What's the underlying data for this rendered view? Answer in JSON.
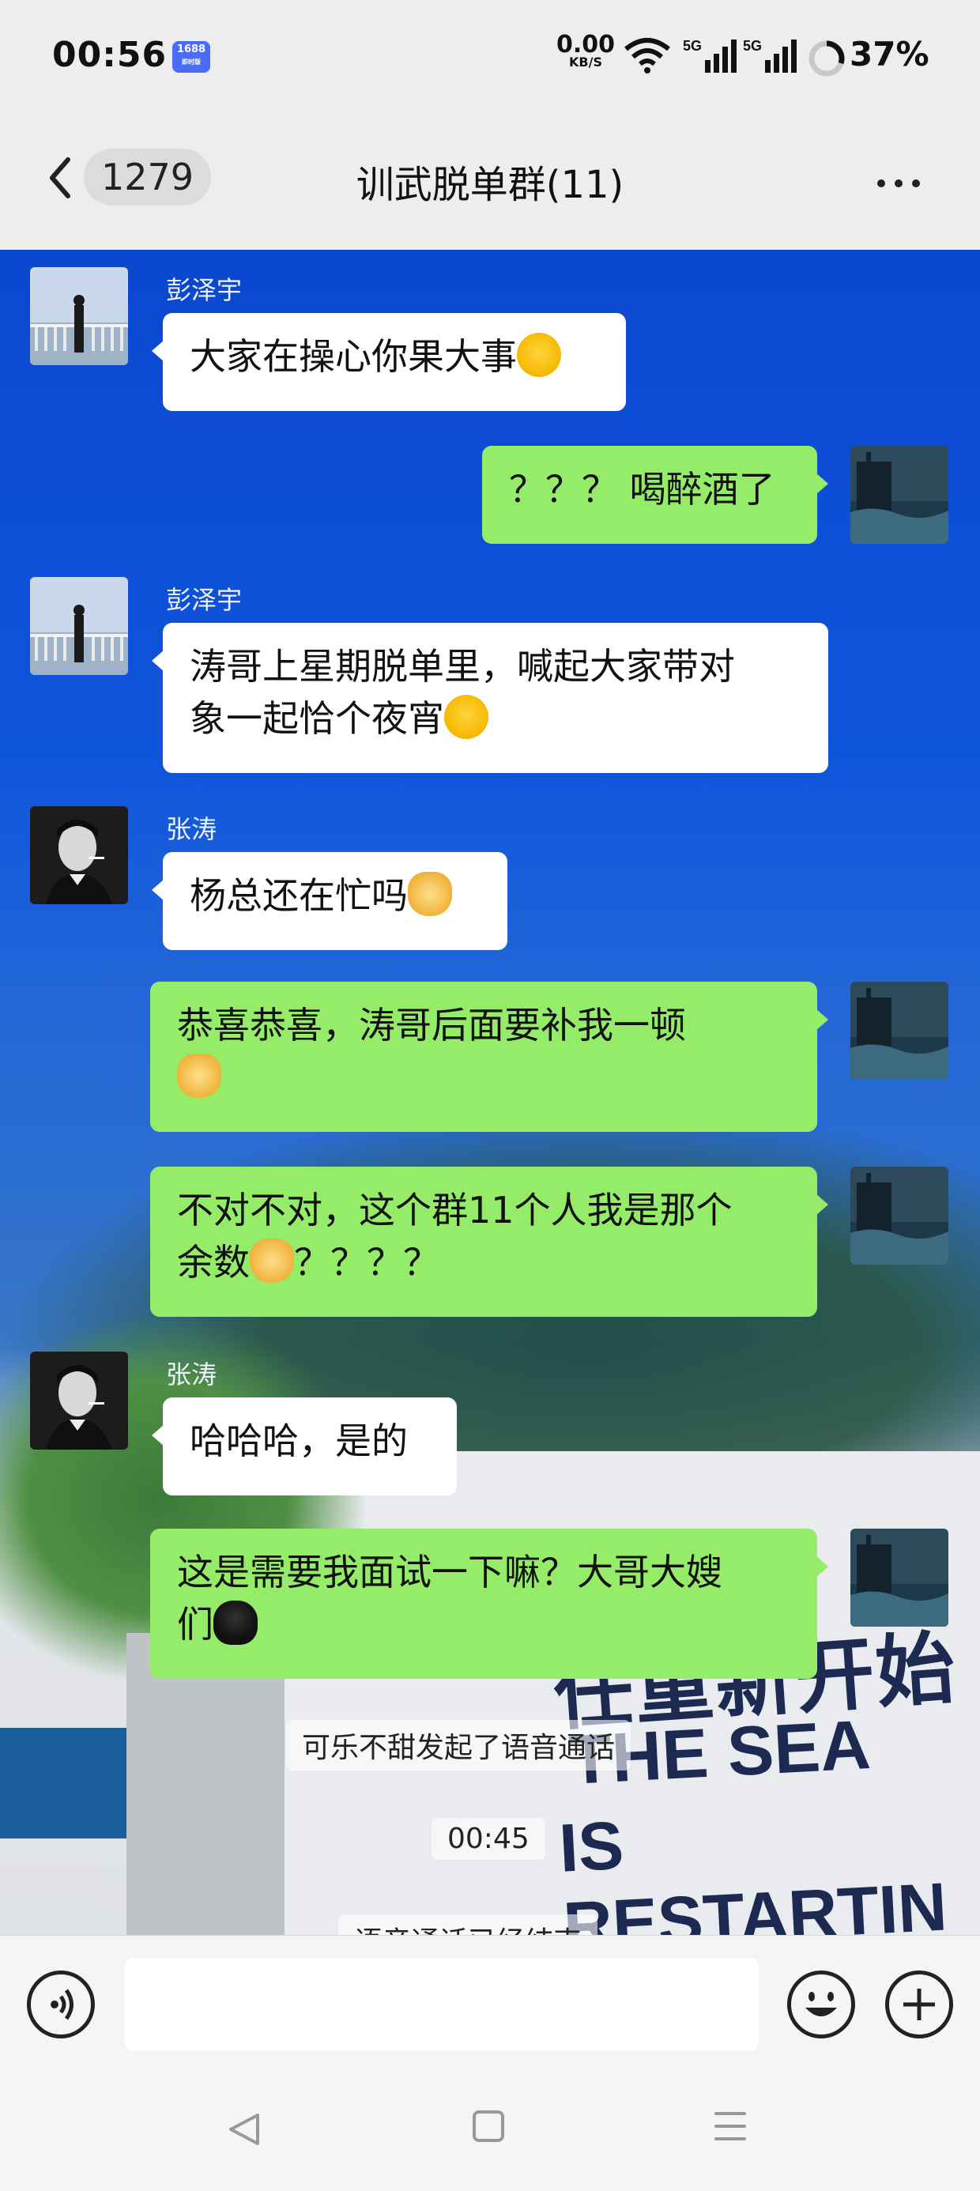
{
  "status_bar": {
    "time": "00:56",
    "app_badge": "1688",
    "app_badge_sub": "即时版",
    "net_speed": "0.00",
    "net_speed_unit": "KB/S",
    "signal1": "5G",
    "signal2": "5G",
    "battery": "37%"
  },
  "header": {
    "unread_count": "1279",
    "title": "训武脱单群(11)"
  },
  "messages": [
    {
      "sender": "彭泽宇",
      "side": "left",
      "text": "大家在操心你果大事",
      "emoji": "laugh-cry"
    },
    {
      "sender": "",
      "side": "right",
      "text": "？？？ 喝醉酒了"
    },
    {
      "sender": "彭泽宇",
      "side": "left",
      "line1": "涛哥上星期脱单里，喊起大家带对",
      "line2": "象一起恰个夜宵",
      "emoji": "laugh-roll"
    },
    {
      "sender": "张涛",
      "side": "left",
      "text": "杨总还在忙吗",
      "emoji": "doge"
    },
    {
      "sender": "",
      "side": "right",
      "line1": "恭喜恭喜，涛哥后面要补我一顿",
      "line2": "",
      "emoji": "doge"
    },
    {
      "sender": "",
      "side": "right",
      "line1": "不对不对，这个群11个人我是那个",
      "line2a": "余数",
      "line2b": "？？？？",
      "emoji": "doge-glasses"
    },
    {
      "sender": "张涛",
      "side": "left",
      "text": "哈哈哈，是的"
    },
    {
      "sender": "",
      "side": "right",
      "line1": "这是需要我面试一下嘛？大哥大嫂",
      "line2": "们",
      "emoji": "qq-penguin"
    }
  ],
  "system": {
    "call_started": "可乐不甜发起了语音通话",
    "call_duration": "00:45",
    "call_ended_partial": "语音通话已经结束"
  },
  "background_text": {
    "line1": "任重新开始",
    "line2": "THE SEA",
    "line3": "IS RESTARTIN"
  },
  "input": {
    "placeholder": ""
  },
  "colors": {
    "bubble_self": "#95ec69",
    "bubble_other": "#ffffff",
    "bar_bg": "#ededed"
  }
}
